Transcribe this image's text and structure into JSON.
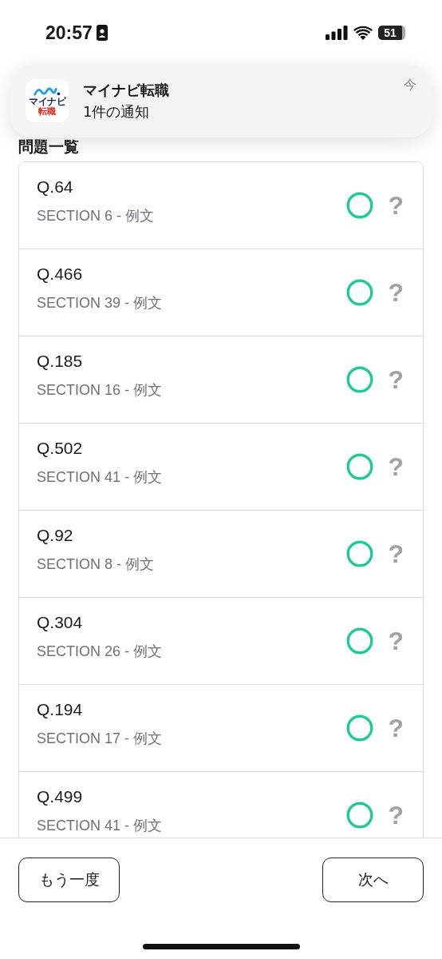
{
  "status_bar": {
    "time": "20:57",
    "battery": "51"
  },
  "notification": {
    "app_logo_lines": [
      "マイナビ",
      "転職"
    ],
    "title": "マイナビ転職",
    "message": "1件の通知",
    "time": "今"
  },
  "heading": "問題一覧",
  "questions": [
    {
      "number": "Q.64",
      "section": "SECTION 6 - 例文",
      "correct": true,
      "help": "?"
    },
    {
      "number": "Q.466",
      "section": "SECTION 39 - 例文",
      "correct": true,
      "help": "?"
    },
    {
      "number": "Q.185",
      "section": "SECTION 16 - 例文",
      "correct": true,
      "help": "?"
    },
    {
      "number": "Q.502",
      "section": "SECTION 41 - 例文",
      "correct": true,
      "help": "?"
    },
    {
      "number": "Q.92",
      "section": "SECTION 8 - 例文",
      "correct": true,
      "help": "?"
    },
    {
      "number": "Q.304",
      "section": "SECTION 26 - 例文",
      "correct": true,
      "help": "?"
    },
    {
      "number": "Q.194",
      "section": "SECTION 17 - 例文",
      "correct": true,
      "help": "?"
    },
    {
      "number": "Q.499",
      "section": "SECTION 41 - 例文",
      "correct": true,
      "help": "?"
    }
  ],
  "buttons": {
    "retry": "もう一度",
    "next": "次へ"
  }
}
